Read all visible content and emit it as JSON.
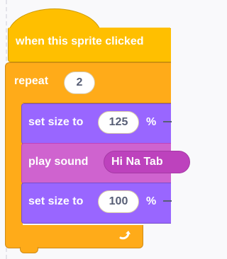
{
  "hat_block": {
    "label": "when this sprite clicked"
  },
  "repeat_block": {
    "label": "repeat",
    "count": "2"
  },
  "blocks": [
    {
      "label": "set size to",
      "value": "125",
      "unit": "%"
    },
    {
      "label": "play sound",
      "value": "Hi Na Tab"
    },
    {
      "label": "set size to",
      "value": "100",
      "unit": "%"
    }
  ],
  "colors": {
    "events": "#ffbf00",
    "control": "#ffab19",
    "looks": "#9966ff",
    "sound": "#cf63cf"
  },
  "icons": {
    "loop": "loop-arrow-icon"
  }
}
